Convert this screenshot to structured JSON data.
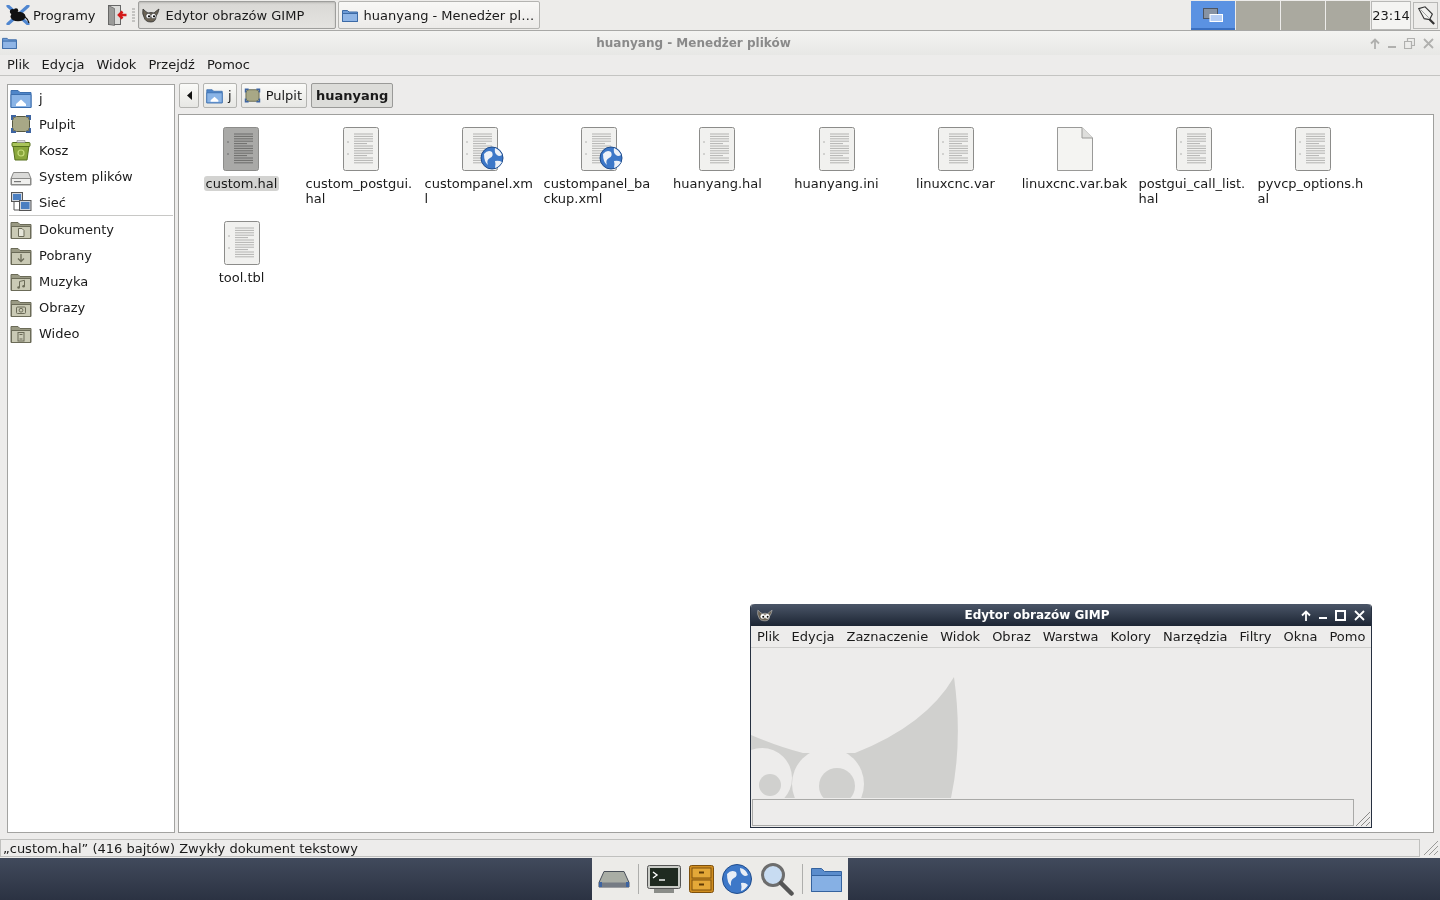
{
  "top_panel": {
    "menu_button": "Programy",
    "tasks": [
      {
        "label": "Edytor obrazów GIMP",
        "kind": "gimp",
        "selected": true
      },
      {
        "label": "huanyang - Menedżer pl…",
        "kind": "folder",
        "selected": false
      }
    ],
    "workspaces": [
      {
        "selected": true,
        "occupied": true
      },
      {
        "selected": false,
        "occupied": false
      },
      {
        "selected": false,
        "occupied": false
      },
      {
        "selected": false,
        "occupied": false
      }
    ],
    "clock": "23:14"
  },
  "file_manager": {
    "title": "huanyang - Menedżer plików",
    "active": false,
    "maximized": true,
    "menu": [
      "Plik",
      "Edycja",
      "Widok",
      "Przejdź",
      "Pomoc"
    ],
    "sidebar": {
      "places": [
        {
          "label": "j",
          "kind": "home",
          "selected": false
        },
        {
          "label": "Pulpit",
          "kind": "desktop",
          "selected": false
        },
        {
          "label": "Kosz",
          "kind": "trash",
          "selected": false
        },
        {
          "label": "System plików",
          "kind": "drive",
          "selected": false
        },
        {
          "label": "Sieć",
          "kind": "network",
          "selected": false
        }
      ],
      "bookmarks": [
        {
          "label": "Dokumenty",
          "kind": "documents",
          "selected": false
        },
        {
          "label": "Pobrany",
          "kind": "downloads",
          "selected": false
        },
        {
          "label": "Muzyka",
          "kind": "music",
          "selected": false
        },
        {
          "label": "Obrazy",
          "kind": "pictures",
          "selected": false
        },
        {
          "label": "Wideo",
          "kind": "videos",
          "selected": false
        }
      ]
    },
    "path_bar": [
      {
        "label": "j",
        "kind": "home",
        "selected": false
      },
      {
        "label": "Pulpit",
        "kind": "desktop",
        "selected": false
      },
      {
        "label": "huanyang",
        "kind": "plain",
        "selected": true
      }
    ],
    "files": [
      {
        "name": "custom.hal",
        "kind": "text",
        "selected": true
      },
      {
        "name": "custom_postgui.hal",
        "kind": "text",
        "selected": false
      },
      {
        "name": "custompanel.xml",
        "kind": "xml",
        "selected": false
      },
      {
        "name": "custompanel_backup.xml",
        "kind": "xml",
        "selected": false
      },
      {
        "name": "huanyang.hal",
        "kind": "text",
        "selected": false
      },
      {
        "name": "huanyang.ini",
        "kind": "text",
        "selected": false
      },
      {
        "name": "linuxcnc.var",
        "kind": "text",
        "selected": false
      },
      {
        "name": "linuxcnc.var.bak",
        "kind": "blank",
        "selected": false
      },
      {
        "name": "postgui_call_list.hal",
        "kind": "text",
        "selected": false
      },
      {
        "name": "pyvcp_options.hal",
        "kind": "text",
        "selected": false
      },
      {
        "name": "tool.tbl",
        "kind": "text",
        "selected": false
      }
    ],
    "status_bar": "„custom.hal” (416 bajtów) Zwykły dokument tekstowy"
  },
  "gimp_window": {
    "title": "Edytor obrazów GIMP",
    "active": true,
    "maximized": false,
    "menu": [
      "Plik",
      "Edycja",
      "Zaznaczenie",
      "Widok",
      "Obraz",
      "Warstwa",
      "Kolory",
      "Narzędzia",
      "Filtry",
      "Okna",
      "Pomo"
    ]
  }
}
